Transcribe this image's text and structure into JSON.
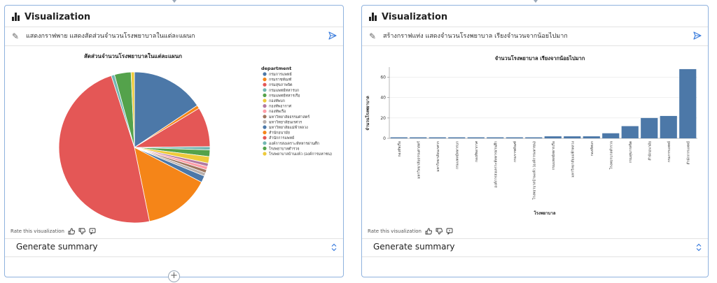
{
  "left_panel": {
    "title": "Visualization",
    "prompt": "แสดงกราฟพาย แสดงสัดส่วนจำนวนโรงพยาบาลในแต่ละแผนก",
    "rate_label": "Rate this visualization",
    "summary_label": "Generate summary",
    "chart_data": {
      "type": "pie",
      "title": "สัดส่วนจำนวนโรงพยาบาลในแต่ละแผนก",
      "legend_title": "department",
      "legend_position": "right",
      "slices": [
        {
          "label": "กรมการแพทย์",
          "value": 22,
          "color": "#4c78a8"
        },
        {
          "label": "กรมราชทัณฑ์",
          "value": 1,
          "color": "#f58518"
        },
        {
          "label": "กรมสุขภาพจิต",
          "value": 12,
          "color": "#e45756"
        },
        {
          "label": "กรมแพทย์ทหารบก",
          "value": 1,
          "color": "#72b7b2"
        },
        {
          "label": "กรมแพทย์ทหารเรือ",
          "value": 2,
          "color": "#54a24b"
        },
        {
          "label": "กองทัพบก",
          "value": 2,
          "color": "#eeca3b"
        },
        {
          "label": "กองทัพอากาศ",
          "value": 1,
          "color": "#b279a2"
        },
        {
          "label": "กองทัพเรือ",
          "value": 1,
          "color": "#ff9da6"
        },
        {
          "label": "มหาวิทยาลัยธรรมศาสตร์",
          "value": 1,
          "color": "#9d755d"
        },
        {
          "label": "มหาวิทยาลัยนเรศวร",
          "value": 1,
          "color": "#bab0ac"
        },
        {
          "label": "มหาวิทยาลัยแม่ฟ้าหลวง",
          "value": 2,
          "color": "#4c78a8"
        },
        {
          "label": "สำนักอนามัย",
          "value": 20,
          "color": "#f58518"
        },
        {
          "label": "สำนักการแพทย์",
          "value": 68,
          "color": "#e45756"
        },
        {
          "label": "องค์การสงเคราะห์ทหารผ่านศึก",
          "value": 1,
          "color": "#72b7b2"
        },
        {
          "label": "โรงพยาบาลตำรวจ",
          "value": 5,
          "color": "#54a24b"
        },
        {
          "label": "โรงพยาบาลบ้านแพ้ว (องค์การมหาชน)",
          "value": 1,
          "color": "#eeca3b"
        }
      ]
    }
  },
  "right_panel": {
    "title": "Visualization",
    "prompt": "สร้างกราฟแท่ง แสดงจำนวนโรงพยาบาล เรียงจำนวนจากน้อยไปมาก",
    "rate_label": "Rate this visualization",
    "summary_label": "Generate summary",
    "chart_data": {
      "type": "bar",
      "title": "จำนวนโรงพยาบาล เรียงจากน้อยไปมาก",
      "xlabel": "โรงพยาบาล",
      "ylabel": "จำนวนโรงพยาบาล",
      "ylim": [
        0,
        70
      ],
      "yticks": [
        0,
        20,
        40,
        60
      ],
      "grid": true,
      "color": "#4c78a8",
      "categories": [
        "กองทัพเรือ",
        "มหาวิทยาลัยธรรมศาสตร์",
        "มหาวิทยาลัยนเรศวร",
        "กรมแพทย์ทหารบก",
        "กองทัพอากาศ",
        "องค์การสงเคราะห์ทหารผ่านศึก",
        "กรมราชทัณฑ์",
        "โรงพยาบาลบ้านแพ้ว (องค์การมหาชน)",
        "กรมแพทย์ทหารเรือ",
        "มหาวิทยาลัยแม่ฟ้าหลวง",
        "กองทัพบก",
        "โรงพยาบาลตำรวจ",
        "กรมสุขภาพจิต",
        "สำนักอนามัย",
        "กรมการแพทย์",
        "สำนักการแพทย์"
      ],
      "values": [
        1,
        1,
        1,
        1,
        1,
        1,
        1,
        1,
        2,
        2,
        2,
        5,
        12,
        20,
        22,
        68
      ]
    }
  }
}
